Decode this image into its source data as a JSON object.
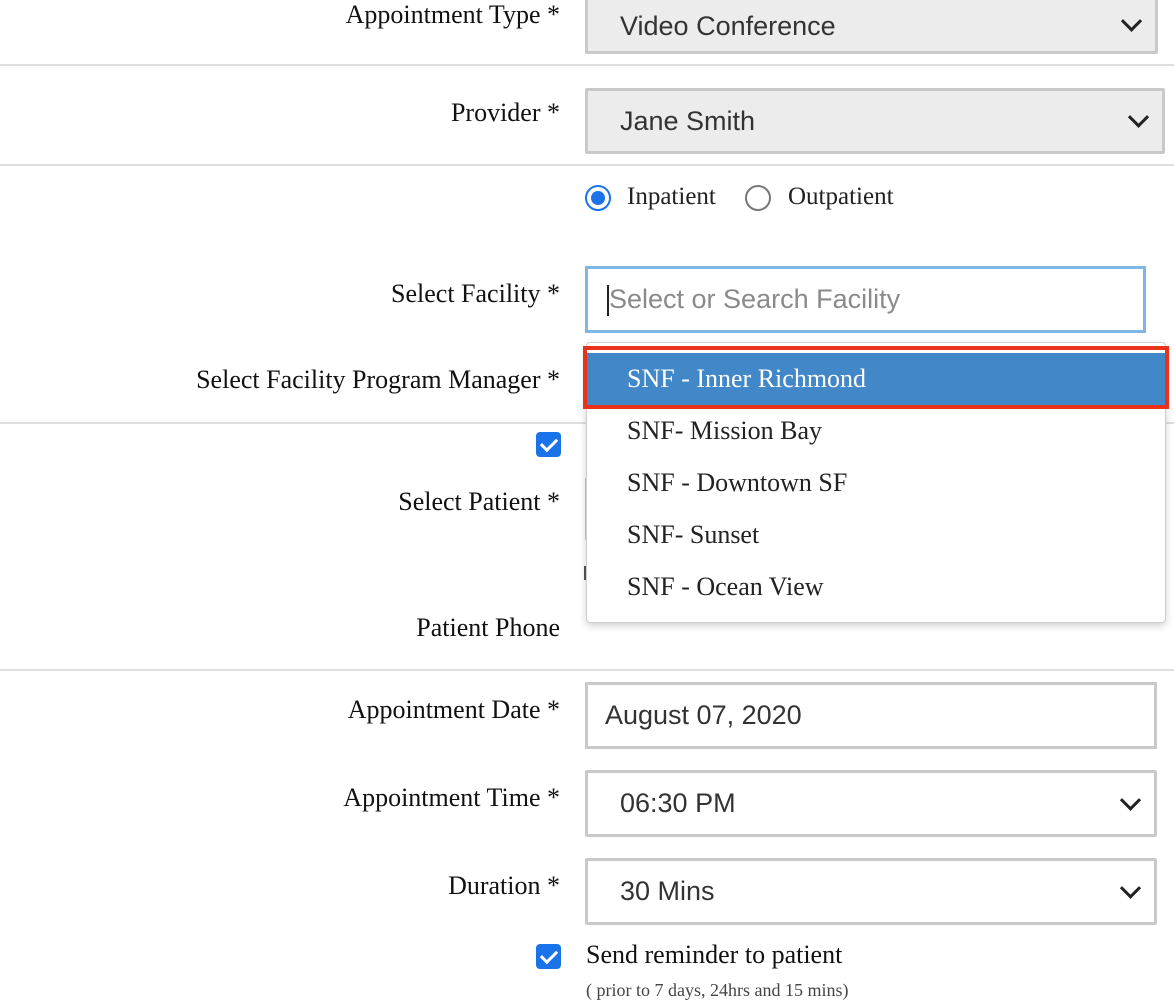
{
  "form": {
    "appointment_type": {
      "label": "Appointment Type *",
      "value": "Video Conference"
    },
    "provider": {
      "label": "Provider *",
      "value": "Jane Smith"
    },
    "patient_type": {
      "options": [
        {
          "label": "Inpatient",
          "selected": true
        },
        {
          "label": "Outpatient",
          "selected": false
        }
      ]
    },
    "facility": {
      "label": "Select Facility *",
      "placeholder": "Select or Search Facility",
      "value": ""
    },
    "facility_program_manager": {
      "label": "Select Facility Program Manager *"
    },
    "select_patient": {
      "label": "Select Patient *"
    },
    "patient_phone": {
      "label": "Patient Phone"
    },
    "appointment_date": {
      "label": "Appointment Date *",
      "value": "August 07, 2020"
    },
    "appointment_time": {
      "label": "Appointment Time *",
      "value": "06:30 PM"
    },
    "duration": {
      "label": "Duration *",
      "value": "30 Mins"
    },
    "reminder": {
      "checked": true,
      "label": "Send reminder to patient",
      "note": "( prior to 7 days, 24hrs and 15 mins)"
    }
  },
  "facility_dropdown": {
    "options": [
      {
        "label": "SNF - Inner Richmond",
        "highlighted": true
      },
      {
        "label": "SNF- Mission Bay",
        "highlighted": false
      },
      {
        "label": "SNF - Downtown SF",
        "highlighted": false
      },
      {
        "label": "SNF- Sunset",
        "highlighted": false
      },
      {
        "label": "SNF - Ocean View",
        "highlighted": false
      }
    ]
  },
  "colors": {
    "accent": "#1a73e8",
    "option_highlight": "#4287c8",
    "annotation_box": "#e8321a",
    "search_focus_border": "#7fb6e6"
  }
}
